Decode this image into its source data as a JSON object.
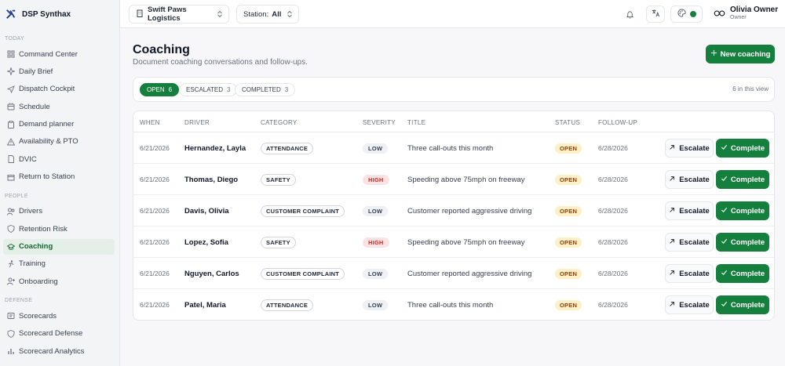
{
  "app": {
    "name": "DSP Synthax"
  },
  "sidebar": {
    "sections": [
      {
        "label": "TODAY",
        "items": [
          {
            "label": "Command Center",
            "icon": "grid-icon"
          },
          {
            "label": "Daily Brief",
            "icon": "sparkle-icon"
          },
          {
            "label": "Dispatch Cockpit",
            "icon": "navigation-icon"
          },
          {
            "label": "Schedule",
            "icon": "calendar-icon"
          },
          {
            "label": "Demand planner",
            "icon": "clipboard-icon"
          },
          {
            "label": "Availability & PTO",
            "icon": "warning-icon"
          },
          {
            "label": "DVIC",
            "icon": "file-icon"
          },
          {
            "label": "Return to Station",
            "icon": "box-icon"
          }
        ]
      },
      {
        "label": "PEOPLE",
        "items": [
          {
            "label": "Drivers",
            "icon": "users-icon"
          },
          {
            "label": "Retention Risk",
            "icon": "shield-icon"
          },
          {
            "label": "Coaching",
            "icon": "graduation-icon",
            "active": true
          },
          {
            "label": "Training",
            "icon": "run-icon"
          },
          {
            "label": "Onboarding",
            "icon": "user-plus-icon"
          }
        ]
      },
      {
        "label": "DEFENSE",
        "items": [
          {
            "label": "Scorecards",
            "icon": "card-icon"
          },
          {
            "label": "Scorecard Defense",
            "icon": "shield-icon"
          },
          {
            "label": "Scorecard Analytics",
            "icon": "chart-icon"
          }
        ]
      }
    ]
  },
  "topbar": {
    "org": "Swift Paws Logistics",
    "station_label": "Station:",
    "station_value": "All",
    "user_name": "Olivia Owner",
    "user_role": "Owner"
  },
  "page": {
    "title": "Coaching",
    "subtitle": "Document coaching conversations and follow-ups.",
    "new_button": "New coaching"
  },
  "filters": {
    "tabs": [
      {
        "label": "OPEN",
        "count": "6",
        "active": true
      },
      {
        "label": "ESCALATED",
        "count": "3"
      },
      {
        "label": "COMPLETED",
        "count": "3"
      }
    ],
    "in_view": "6 in this view"
  },
  "table": {
    "columns": [
      "WHEN",
      "DRIVER",
      "CATEGORY",
      "SEVERITY",
      "TITLE",
      "STATUS",
      "FOLLOW-UP"
    ],
    "escalate_label": "Escalate",
    "complete_label": "Complete",
    "rows": [
      {
        "when": "6/21/2026",
        "driver": "Hernandez, Layla",
        "category": "ATTENDANCE",
        "severity": "LOW",
        "title": "Three call-outs this month",
        "status": "OPEN",
        "follow_up": "6/28/2026"
      },
      {
        "when": "6/21/2026",
        "driver": "Thomas, Diego",
        "category": "SAFETY",
        "severity": "HIGH",
        "title": "Speeding above 75mph on freeway",
        "status": "OPEN",
        "follow_up": "6/28/2026"
      },
      {
        "when": "6/21/2026",
        "driver": "Davis, Olivia",
        "category": "CUSTOMER COMPLAINT",
        "severity": "LOW",
        "title": "Customer reported aggressive driving",
        "status": "OPEN",
        "follow_up": "6/28/2026"
      },
      {
        "when": "6/21/2026",
        "driver": "Lopez, Sofia",
        "category": "SAFETY",
        "severity": "HIGH",
        "title": "Speeding above 75mph on freeway",
        "status": "OPEN",
        "follow_up": "6/28/2026"
      },
      {
        "when": "6/21/2026",
        "driver": "Nguyen, Carlos",
        "category": "CUSTOMER COMPLAINT",
        "severity": "LOW",
        "title": "Customer reported aggressive driving",
        "status": "OPEN",
        "follow_up": "6/28/2026"
      },
      {
        "when": "6/21/2026",
        "driver": "Patel, Maria",
        "category": "ATTENDANCE",
        "severity": "LOW",
        "title": "Three call-outs this month",
        "status": "OPEN",
        "follow_up": "6/28/2026"
      }
    ]
  },
  "colors": {
    "accent": "#15803d",
    "active_bg": "#e3efe7",
    "high": "#dc2626",
    "open": "#fdf0c6"
  }
}
